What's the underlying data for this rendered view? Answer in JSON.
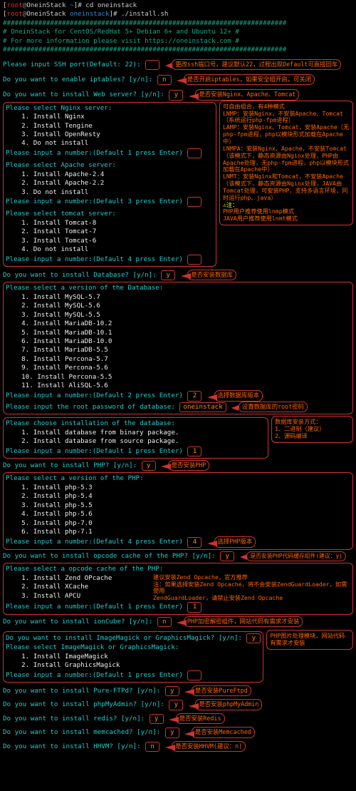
{
  "prompt1": {
    "user": "root",
    "host": "OneinStack",
    "path": "~",
    "cmd": "cd oneinstack"
  },
  "prompt2": {
    "user": "root",
    "host": "OneinStack",
    "path": "oneinstack",
    "cmd": "./install.sh"
  },
  "banner": {
    "border": "########################################################################",
    "l1": "#       OneinStack for CentOS/RedHat 5+ Debian 6+ and Ubuntu 12+       #",
    "l2": "#       For more information please visit https://oneinstack.com      #"
  },
  "ssh": {
    "q": "Please input SSH port(Default: 22):",
    "note": "更改ssh端口号，建议默认22，过程出现Default可直接回车"
  },
  "iptables": {
    "q": "Do you want to enable iptables? [y/n]:",
    "a": "n",
    "note": "是否开启iptables，如果安全组开启，可关闭"
  },
  "web": {
    "q": "Do you want to install Web server? [y/n]:",
    "a": "y",
    "note": "是否安装Nginx、Apache、Tomcat"
  },
  "servers": {
    "nginx": {
      "title": "Please select Nginx server:",
      "items": [
        "Install Nginx",
        "Install Tengine",
        "Install OpenResty",
        "Do not install"
      ],
      "prompt": "Please input a number:(Default 1 press Enter)"
    },
    "apache": {
      "title": "Please select Apache server:",
      "items": [
        "Install Apache-2.4",
        "Install Apache-2.2",
        "Do not install"
      ],
      "prompt": "Please input a number:(Default 3 press Enter)"
    },
    "tomcat": {
      "title": "Please select tomcat server:",
      "items": [
        "Install Tomcat-8",
        "Install Tomcat-7",
        "Install Tomcat-6",
        "Do not install"
      ],
      "prompt": "Please input a number:(Default 4 press Enter)"
    },
    "help": [
      "可自由组合，有4种模式",
      "LNMP：安装Nginx，不安装Apache、Tomcat（系统运行php-fpm进程）",
      "LAMP：安装Nginx、Tomcat，安装Apache（无php-fpm进程，php以模块形式加载在Apache中）",
      "LNMPA：安装Nginx、Apache，不安装Tomcat（该模式下，静态资源由Nginx处理，PHP由Apache处理，无php-fpm进程，php以模块形式加载在Apache中）",
      "LNMT：安装Nginx和Tomcat，不安装Apache（该模式下，静态资源由Nginx处理，JAVA由Tomcat处理，可安装PHP，支持多语言环境，同时运行php、java）",
      "⚠注：",
      "  PHP用户推荐使用lnmp模式",
      "  JAVA用户推荐使用lnmt模式"
    ]
  },
  "db": {
    "q": "Do you want to install Database? [y/n]:",
    "a": "y",
    "note": "是否安装数据库",
    "vtitle": "Please select a version of the Database:",
    "items": [
      "Install MySQL-5.7",
      "Install MySQL-5.6",
      "Install MySQL-5.5",
      "Install MariaDB-10.2",
      "Install MariaDB-10.1",
      "Install MariaDB-10.0",
      "Install MariaDB-5.5",
      "Install Percona-5.7",
      "Install Percona-5.6",
      "Install Percona-5.5",
      "Install AliSQL-5.6"
    ],
    "nump": "Please input a number:(Default 2 press Enter)",
    "numa": "2",
    "numnote": "选择数据库版本",
    "pwq": "Please input the root password of database:",
    "pwa": "oneinstack",
    "pwnote": "设置数据库的root密码",
    "insttitle": "Please choose installation of the database:",
    "instopts": [
      "Install database from binary package.",
      "Install database from source package."
    ],
    "instp": "Please input a number:(Default 1 press Enter)",
    "insta": "1",
    "insthelp": [
      "数据库安装方式：",
      "1、二进制（建议）",
      "2、源码编译"
    ]
  },
  "php": {
    "q": "Do you want to install PHP? [y/n]:",
    "a": "y",
    "note": "是否安装PHP",
    "vtitle": "Please select a version of the PHP:",
    "items": [
      "Install php-5.3",
      "Install php-5.4",
      "Install php-5.5",
      "Install php-5.6",
      "Install php-7.0",
      "Install php-7.1"
    ],
    "nump": "Please input a number:(Default 4 press Enter)",
    "numa": "4",
    "numnote": "选择PHP版本"
  },
  "opcode": {
    "q": "Do you want to install opcode cache of the PHP? [y/n]:",
    "a": "y",
    "note": "是否安装PHP代码缓存组件(建议：y)",
    "otitle": "Please select a opcode cache of the PHP:",
    "items": [
      "Install Zend OPcache",
      "Install XCache",
      "Install APCU"
    ],
    "nump": "Please input a number:(Default 1 press Enter)",
    "numa": "1",
    "help": [
      "建议安装Zend Opcache，官方推荐",
      "注：如果选择安装Zend Opcache，将不会安装ZendGuardLoader，如需使用",
      "ZendGuardLoader，请禁止安装Zend Opcache"
    ]
  },
  "ioncube": {
    "q": "Do you want to install ionCube? [y/n]:",
    "a": "n",
    "note": "PHP加密解密组件，网站代码有需求才安装"
  },
  "magick": {
    "q": "Do you want to install ImageMagick or GraphicsMagick? [y/n]:",
    "a": "y",
    "note": "PHP图片处理模块，网站代码有需求才安装",
    "sel": "Please select ImageMagick or GraphicsMagick:",
    "items": [
      "Install ImageMagick",
      "Install GraphicsMagick"
    ],
    "nump": "Please input a number:(Default 1 press Enter)"
  },
  "ftp": {
    "q": "Do you want to install Pure-FTPd? [y/n]:",
    "a": "y",
    "note": "是否安装PureFtpd"
  },
  "pma": {
    "q": "Do you want to install phpMyAdmin? [y/n]:",
    "a": "y",
    "note": "是否安装phpMyAdmin"
  },
  "redis": {
    "q": "Do you want to install redis? [y/n]:",
    "a": "y",
    "note": "是否安装Redis"
  },
  "memcached": {
    "q": "Do you want to install memcached? [y/n]:",
    "a": "y",
    "note": "是否安装Memcached"
  },
  "hhvm": {
    "q": "Do you want to install HHVM? [y/n]:",
    "a": "n",
    "note": "是否安装HHVM(建议：n)"
  }
}
